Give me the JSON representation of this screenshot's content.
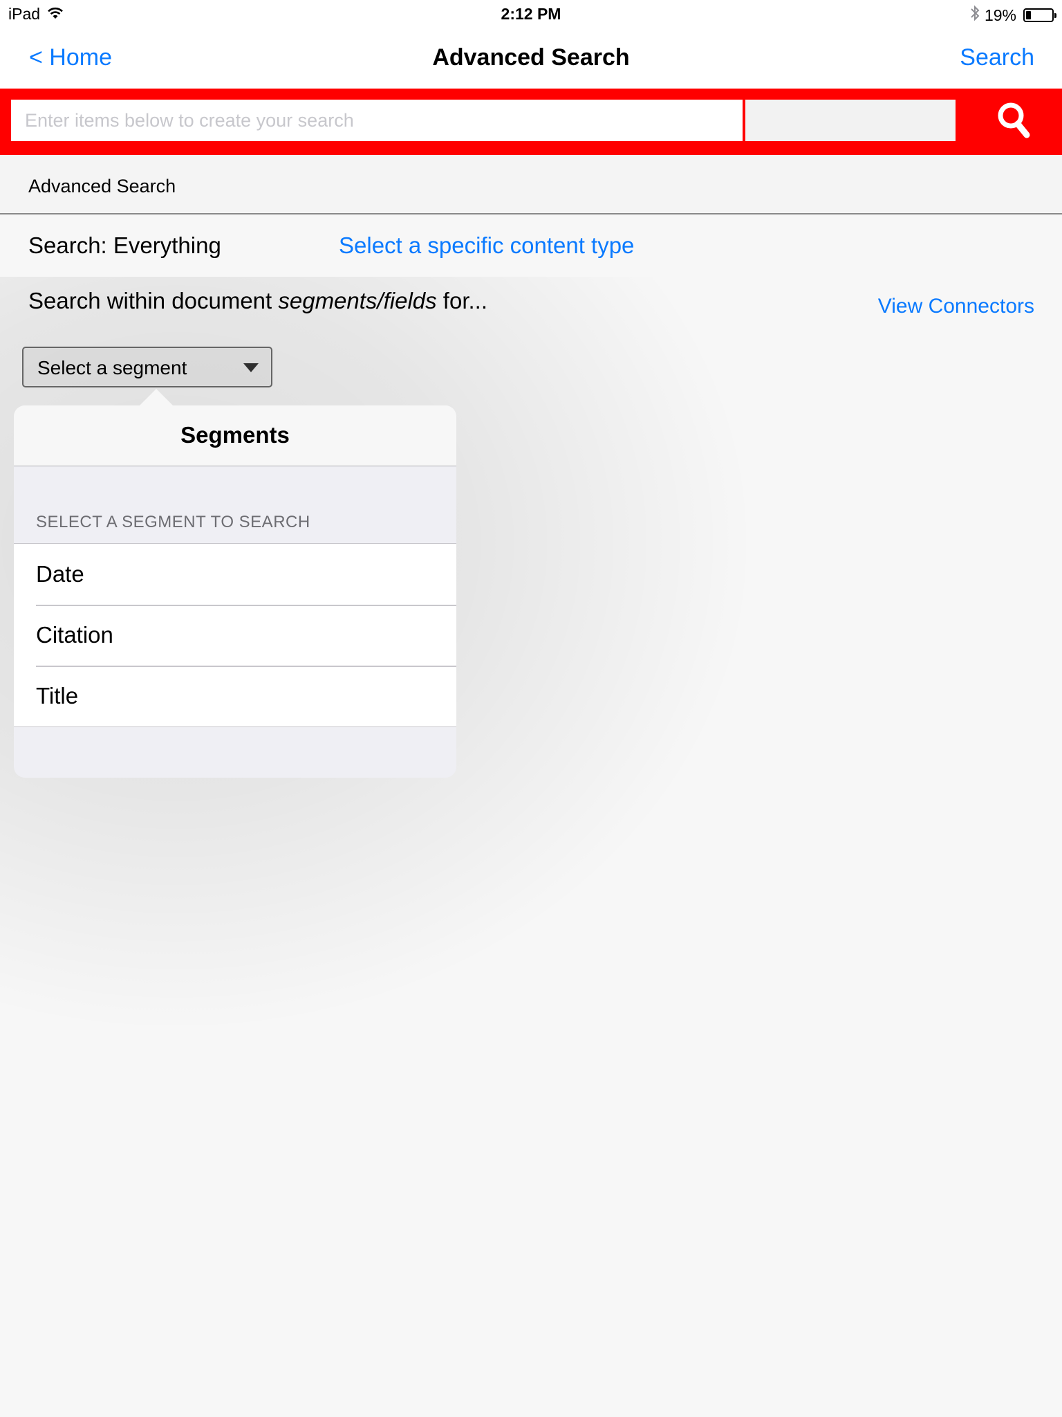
{
  "status_bar": {
    "device": "iPad",
    "time": "2:12 PM",
    "battery_percent_label": "19%",
    "battery_level": 0.19,
    "icons": [
      "wifi-icon",
      "bluetooth-icon",
      "battery-icon"
    ]
  },
  "nav": {
    "back_label": "< Home",
    "title": "Advanced Search",
    "search_label": "Search"
  },
  "search_band": {
    "placeholder": "Enter items below to create your search",
    "value": "",
    "secondary_value": "",
    "go_icon": "search-icon",
    "brand_color": "#ff0000"
  },
  "section_header": {
    "label": "Advanced Search"
  },
  "content": {
    "scope_label": "Search: Everything",
    "content_type_link": "Select a specific content type",
    "within_prefix": "Search within document ",
    "within_emphasis": "segments/fields",
    "within_suffix": " for...",
    "connectors_link": "View Connectors",
    "segment_select_label": "Select a segment",
    "link_color": "#0a7aff"
  },
  "popover": {
    "title": "Segments",
    "section_label": "SELECT A SEGMENT TO SEARCH",
    "items": [
      {
        "label": "Date"
      },
      {
        "label": "Citation"
      },
      {
        "label": "Title"
      }
    ]
  }
}
